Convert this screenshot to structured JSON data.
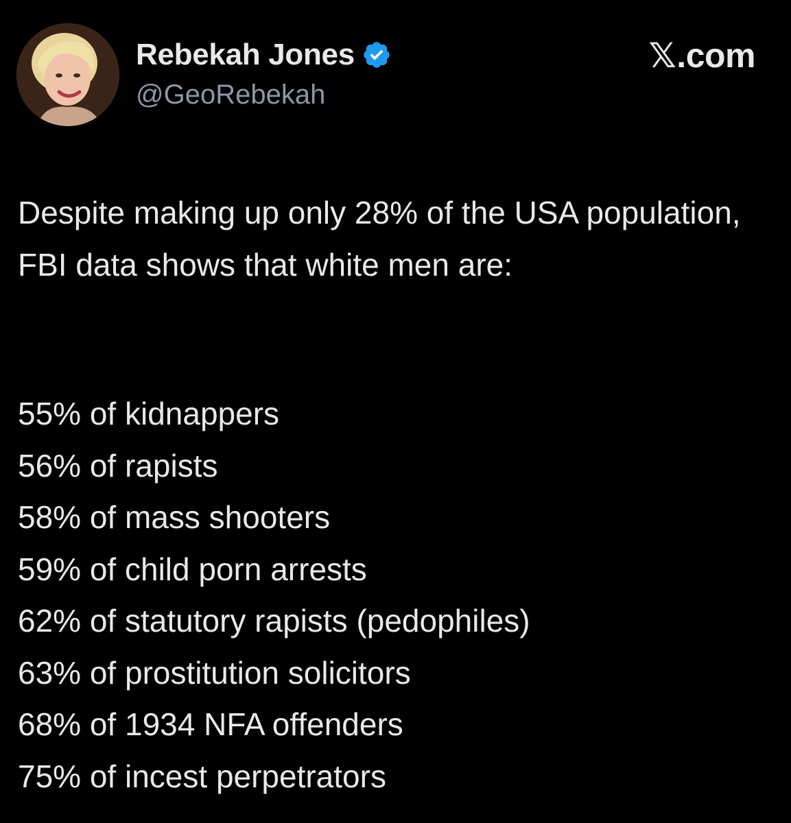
{
  "author": {
    "display_name": "Rebekah Jones",
    "handle": "@GeoRebekah",
    "verified": true,
    "avatar_icon": "profile-photo"
  },
  "brand": {
    "logo": "𝕏",
    "domain": ".com"
  },
  "post": {
    "intro": "Despite making up only 28% of the USA population, FBI data shows that white men are:",
    "stats": [
      "55% of kidnappers",
      "56% of rapists",
      "58% of mass shooters",
      "59% of child porn arrests",
      "62% of statutory rapists (pedophiles)",
      "63% of prostitution solicitors",
      "68% of 1934 NFA offenders",
      "75% of incest perpetrators"
    ]
  },
  "colors": {
    "background": "#000000",
    "text": "#e7e9ea",
    "handle": "#8b98a5",
    "verified_badge": "#1d9bf0"
  }
}
